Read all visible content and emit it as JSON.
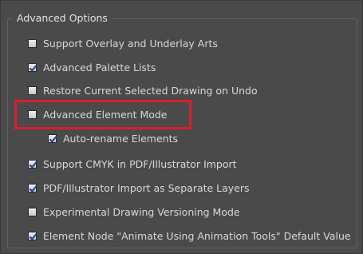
{
  "section": {
    "title": "Advanced Options"
  },
  "options": [
    {
      "label": "Support Overlay and Underlay Arts",
      "checked": false
    },
    {
      "label": "Advanced Palette Lists",
      "checked": true
    },
    {
      "label": "Restore Current Selected Drawing on Undo",
      "checked": false
    },
    {
      "label": "Advanced Element Mode",
      "checked": false,
      "highlighted": true
    },
    {
      "label": "Auto-rename Elements",
      "checked": true,
      "indented": true
    },
    {
      "label": "Support CMYK in PDF/Illustrator Import",
      "checked": true
    },
    {
      "label": "PDF/Illustrator Import as Separate Layers",
      "checked": true
    },
    {
      "label": "Experimental Drawing Versioning Mode",
      "checked": false
    },
    {
      "label": "Element Node \"Animate Using Animation Tools\" Default Value",
      "checked": true
    }
  ],
  "colors": {
    "background": "#4a4a4a",
    "text": "#d8d8d8",
    "highlight_border": "#d9202a",
    "checkmark": "#1c3c9c"
  }
}
